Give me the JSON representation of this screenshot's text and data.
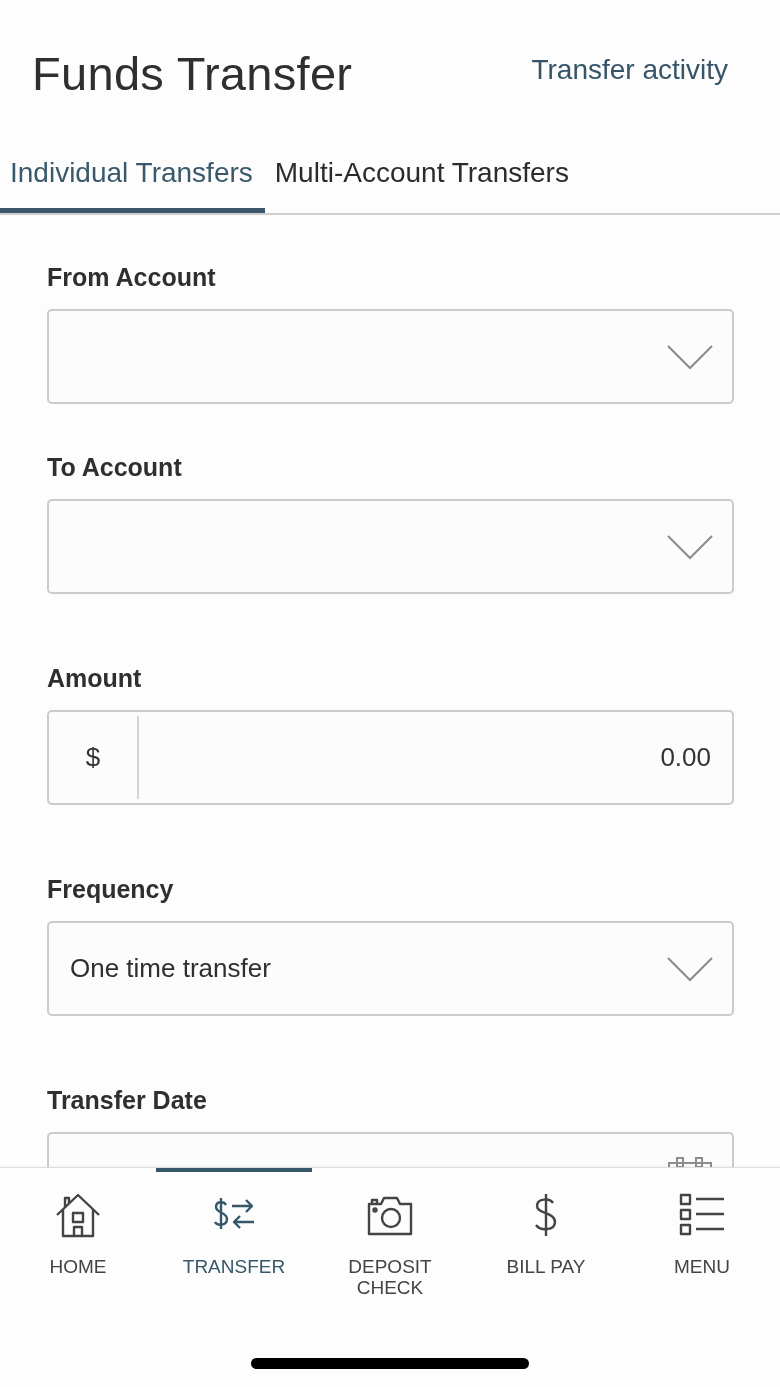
{
  "header": {
    "title": "Funds Transfer",
    "link": "Transfer activity"
  },
  "tabs": [
    {
      "label": "Individual Transfers",
      "selected": true
    },
    {
      "label": "Multi-Account Transfers",
      "selected": false
    }
  ],
  "form": {
    "fields": [
      {
        "kind": "select",
        "label": "From Account"
      },
      {
        "kind": "select",
        "label": "To Account"
      },
      {
        "kind": "amount",
        "label": "Amount",
        "prefix": "$",
        "value": "0.00"
      },
      {
        "kind": "select",
        "label": "Frequency",
        "value": "One time transfer"
      },
      {
        "kind": "date",
        "label": "Transfer Date"
      }
    ]
  },
  "bottom_nav": [
    {
      "kind": "home",
      "label": "HOME",
      "selected": false
    },
    {
      "kind": "transfer",
      "label": "TRANSFER",
      "selected": true
    },
    {
      "kind": "deposit",
      "label": "DEPOSIT CHECK",
      "selected": false
    },
    {
      "kind": "billpay",
      "label": "BILL PAY",
      "selected": false
    },
    {
      "kind": "menu",
      "label": "MENU",
      "selected": false
    }
  ]
}
